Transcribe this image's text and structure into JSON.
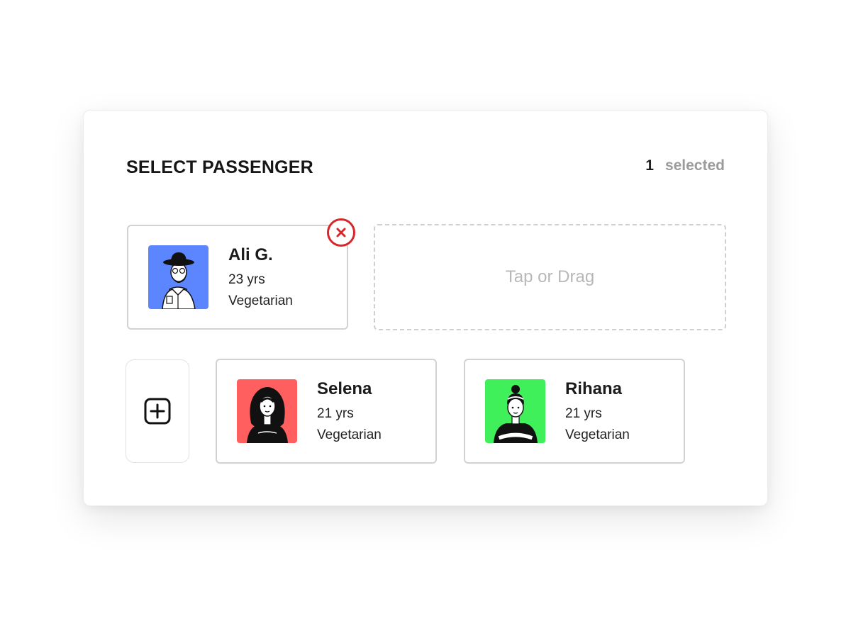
{
  "header": {
    "title": "SELECT PASSENGER",
    "selected_count": "1",
    "selected_label": "selected"
  },
  "selected_passenger": {
    "name": "Ali G.",
    "age": "23 yrs",
    "diet": "Vegetarian",
    "avatar_color": "#5b86ff",
    "remove_icon": "close-circle-icon",
    "remove_color": "#d8262a"
  },
  "dropzone": {
    "label": "Tap or Drag"
  },
  "add_button": {
    "icon": "plus-square-icon"
  },
  "passengers": [
    {
      "name": "Selena",
      "age": "21 yrs",
      "diet": "Vegetarian",
      "avatar_color": "#ff5f5f"
    },
    {
      "name": "Rihana",
      "age": "21 yrs",
      "diet": "Vegetarian",
      "avatar_color": "#3ff05a"
    }
  ]
}
